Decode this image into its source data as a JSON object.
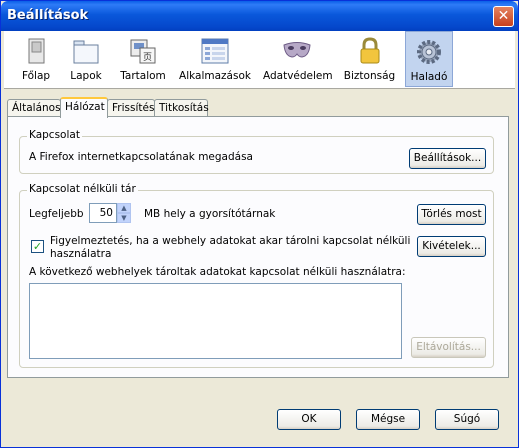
{
  "window": {
    "title": "Beállítások"
  },
  "toolbar": {
    "items": [
      {
        "label": "Főlap",
        "icon": "main-page-icon"
      },
      {
        "label": "Lapok",
        "icon": "tabs-icon"
      },
      {
        "label": "Tartalom",
        "icon": "content-icon"
      },
      {
        "label": "Alkalmazások",
        "icon": "applications-icon"
      },
      {
        "label": "Adatvédelem",
        "icon": "privacy-mask-icon"
      },
      {
        "label": "Biztonság",
        "icon": "security-lock-icon"
      },
      {
        "label": "Haladó",
        "icon": "advanced-gear-icon"
      }
    ],
    "selected": "Haladó"
  },
  "tabs": [
    "Általános",
    "Hálózat",
    "Frissítés",
    "Titkosítás"
  ],
  "active_tab": "Hálózat",
  "connection": {
    "legend": "Kapcsolat",
    "description": "A Firefox internetkapcsolatának megadása",
    "settings_button": "Beállítások..."
  },
  "offline": {
    "legend": "Kapcsolat nélküli tár",
    "limit_label": "Legfeljebb",
    "limit_value": "50",
    "limit_unit": "MB hely a gyorsítótárnak",
    "clear_button": "Törlés most",
    "warn_checked": true,
    "warn_line1": "Figyelmeztetés, ha a webhely adatokat akar tárolni kapcsolat nélküli",
    "warn_line2": "használatra",
    "exceptions_button": "Kivételek...",
    "list_label": "A következő webhelyek tároltak adatokat kapcsolat nélküli használatra:",
    "remove_button": "Eltávolítás..."
  },
  "footer": {
    "ok": "OK",
    "cancel": "Mégse",
    "help": "Súgó"
  }
}
